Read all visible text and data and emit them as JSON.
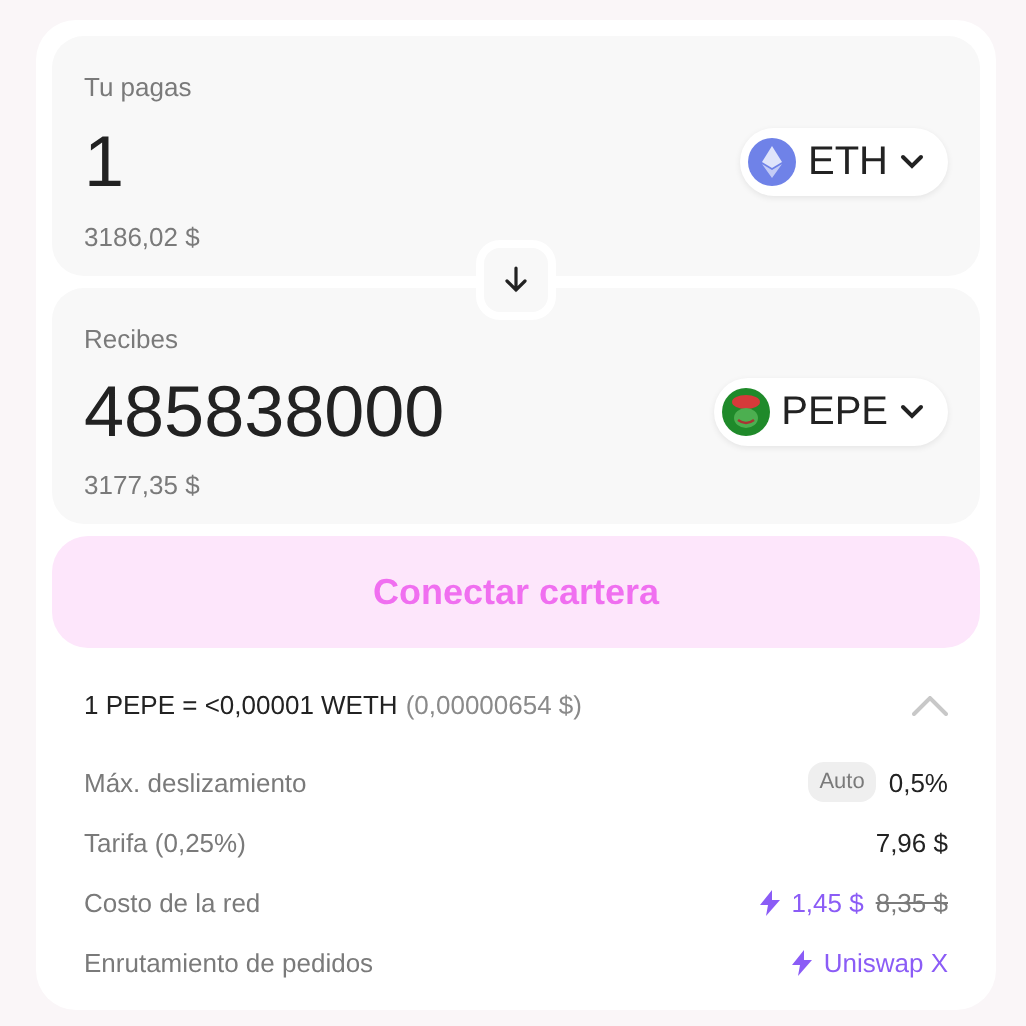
{
  "pay": {
    "label": "Tu pagas",
    "amount": "1",
    "usd": "3186,02 $",
    "token": "ETH"
  },
  "receive": {
    "label": "Recibes",
    "amount": "485838000",
    "usd": "3177,35 $",
    "token": "PEPE"
  },
  "connect_button": "Conectar cartera",
  "details": {
    "rate": "1 PEPE = <0,00001 WETH",
    "rate_usd": "(0,00000654 $)",
    "expanded": true,
    "rows": [
      {
        "kind": "badge",
        "label": "Máx. deslizamiento",
        "badge": "Auto",
        "value": "0,5%"
      },
      {
        "kind": "plain",
        "label": "Tarifa (0,25%)",
        "value": "7,96 $"
      },
      {
        "kind": "fee",
        "label": "Costo de la red",
        "value": "1,45 $",
        "old_value": "8,35 $"
      },
      {
        "kind": "route",
        "label": "Enrutamiento de pedidos",
        "value": "Uniswap X"
      }
    ]
  }
}
